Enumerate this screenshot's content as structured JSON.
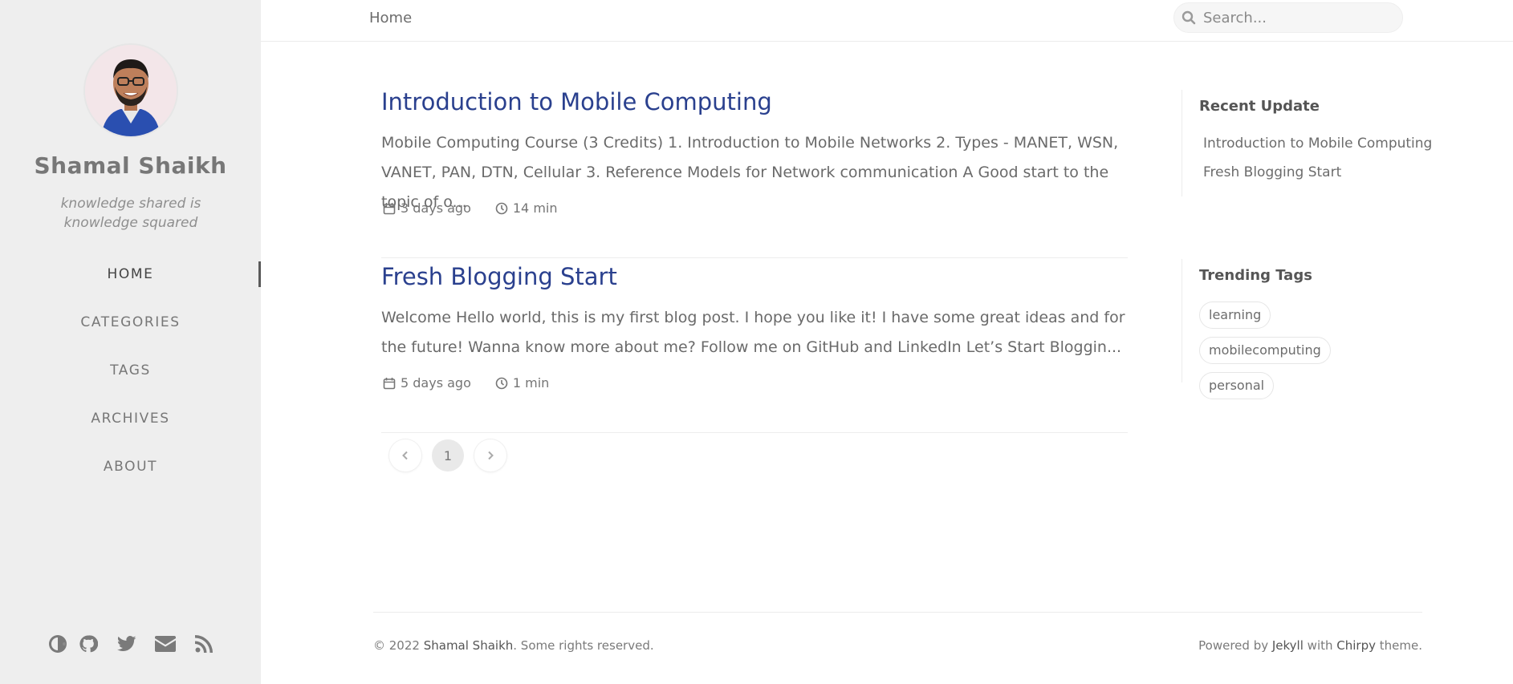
{
  "sidebar": {
    "title": "Shamal Shaikh",
    "subtitle": "knowledge shared is knowledge squared",
    "nav": [
      {
        "label": "HOME",
        "active": true
      },
      {
        "label": "CATEGORIES"
      },
      {
        "label": "TAGS"
      },
      {
        "label": "ARCHIVES"
      },
      {
        "label": "ABOUT"
      }
    ],
    "bottom_icons": [
      "theme-toggle-icon",
      "github-icon",
      "twitter-icon",
      "email-icon",
      "rss-icon"
    ]
  },
  "topbar": {
    "breadcrumb": "Home",
    "search_placeholder": "Search..."
  },
  "posts": [
    {
      "title": "Introduction to Mobile Computing",
      "excerpt": "Mobile Computing Course (3 Credits) 1. Introduction to Mobile Networks 2. Types - MANET, WSN, VANET, PAN, DTN, Cellular 3. Reference Models for Network communication A Good start to the topic of o...",
      "date": "3 days ago",
      "read_time": "14 min"
    },
    {
      "title": "Fresh Blogging Start",
      "excerpt": "Welcome Hello world, this is my first blog post. I hope you like it! I have some great ideas and for the future! Wanna know more about me? Follow me on GitHub and LinkedIn Let’s Start Bloggin...",
      "date": "5 days ago",
      "read_time": "1 min"
    }
  ],
  "pagination": {
    "current": "1"
  },
  "panel": {
    "recent_heading": "Recent Update",
    "recent": [
      "Introduction to Mobile Computing",
      "Fresh Blogging Start"
    ],
    "trending_heading": "Trending Tags",
    "tags": [
      "learning",
      "mobilecomputing",
      "personal"
    ]
  },
  "footer": {
    "copyright_prefix": "© 2022 ",
    "owner": "Shamal Shaikh",
    "rights": ". Some rights reserved.",
    "powered_by": "Powered by ",
    "jekyll": "Jekyll",
    "with": " with ",
    "chirpy": "Chirpy",
    "theme": " theme."
  },
  "colors": {
    "sidebar_bg": "#eeeeee",
    "post_title": "#2a408e",
    "text": "#6a6a6a"
  }
}
